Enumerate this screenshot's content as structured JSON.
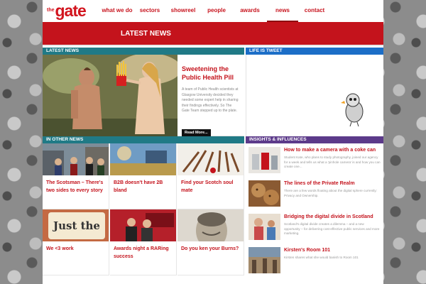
{
  "logo": {
    "small": "the",
    "main": "gate"
  },
  "nav": [
    {
      "label": "what we do",
      "active": false,
      "w": 46
    },
    {
      "label": "sectors",
      "active": false,
      "w": 46
    },
    {
      "label": "showreel",
      "active": false,
      "w": 48
    },
    {
      "label": "people",
      "active": false,
      "w": 46
    },
    {
      "label": "awards",
      "active": false,
      "w": 48
    },
    {
      "label": "news",
      "active": true,
      "w": 44
    },
    {
      "label": "contact",
      "active": false,
      "w": 46
    }
  ],
  "banner": {
    "title": "LATEST NEWS"
  },
  "latest": {
    "header": "LATEST NEWS",
    "title": "Sweetening the Public Health Pill",
    "body": "A team of Public Health scientists at Glasgow University decided they needed some expert help in sharing their findings effectively. So The Gate Team stepped up to the plate.",
    "more": "Read More..."
  },
  "tweet": {
    "header": "LIFE IS TWEET"
  },
  "other_news": {
    "header": "IN OTHER NEWS",
    "items": [
      {
        "title": "The Scotsman – There's two sides to every story"
      },
      {
        "title": "B2B doesn't have 2B bland"
      },
      {
        "title": "Find your Scotch soul mate"
      },
      {
        "title": "We <3 work",
        "img_text": "Just the"
      },
      {
        "title": "Awards night a RARing success"
      },
      {
        "title": "Do you ken your Burns?"
      }
    ]
  },
  "insights": {
    "header": "INSIGHTS & INFLUENCES",
    "items": [
      {
        "title": "How to make a camera with a coke can",
        "body": "Student Kate, who plans to study photography, joined our agency for a week and tells us what a 'pinhole camera' is and how you can create one..."
      },
      {
        "title": "The lines of the Private Realm",
        "body": "There are a few words floating about the digital sphere currently: Privacy and Ownership."
      },
      {
        "title": "Bridging the digital divide in Scotland",
        "body": "Scotland's digital divide creates a dilemma – and a new opportunity – for delivering cost-effective public services and more marketing."
      },
      {
        "title": "Kirsten's Room 101",
        "body": "Kirsten shares what she would banish to Room 101"
      }
    ]
  },
  "colors": {
    "brand": "#c4131c",
    "teal": "#207a86",
    "blue": "#1c6ec7",
    "purple": "#5c3a8a"
  }
}
